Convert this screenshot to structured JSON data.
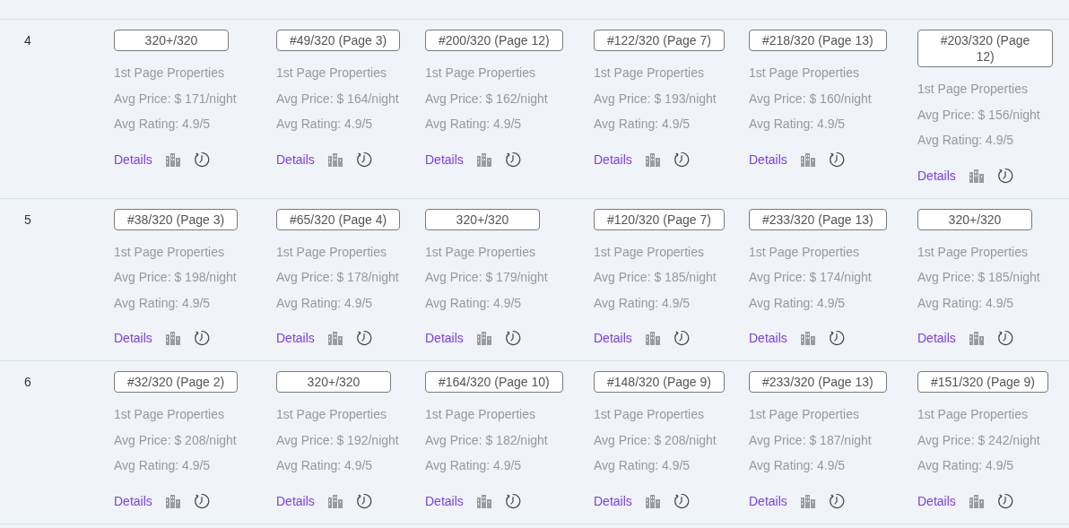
{
  "rows": [
    {
      "number": "4",
      "cells": [
        {
          "rank": "320+/320",
          "label": "1st Page Properties",
          "price": "Avg Price: $ 171/night",
          "rating": "Avg Rating: 4.9/5",
          "link": "Details"
        },
        {
          "rank": "#49/320 (Page 3)",
          "label": "1st Page Properties",
          "price": "Avg Price: $ 164/night",
          "rating": "Avg Rating: 4.9/5",
          "link": "Details"
        },
        {
          "rank": "#200/320 (Page 12)",
          "label": "1st Page Properties",
          "price": "Avg Price: $ 162/night",
          "rating": "Avg Rating: 4.9/5",
          "link": "Details"
        },
        {
          "rank": "#122/320 (Page 7)",
          "label": "1st Page Properties",
          "price": "Avg Price: $ 193/night",
          "rating": "Avg Rating: 4.9/5",
          "link": "Details"
        },
        {
          "rank": "#218/320 (Page 13)",
          "label": "1st Page Properties",
          "price": "Avg Price: $ 160/night",
          "rating": "Avg Rating: 4.9/5",
          "link": "Details"
        },
        {
          "rank": "#203/320 (Page 12)",
          "label": "1st Page Properties",
          "price": "Avg Price: $ 156/night",
          "rating": "Avg Rating: 4.9/5",
          "link": "Details"
        }
      ]
    },
    {
      "number": "5",
      "cells": [
        {
          "rank": "#38/320 (Page 3)",
          "label": "1st Page Properties",
          "price": "Avg Price: $ 198/night",
          "rating": "Avg Rating: 4.9/5",
          "link": "Details"
        },
        {
          "rank": "#65/320 (Page 4)",
          "label": "1st Page Properties",
          "price": "Avg Price: $ 178/night",
          "rating": "Avg Rating: 4.9/5",
          "link": "Details"
        },
        {
          "rank": "320+/320",
          "label": "1st Page Properties",
          "price": "Avg Price: $ 179/night",
          "rating": "Avg Rating: 4.9/5",
          "link": "Details"
        },
        {
          "rank": "#120/320 (Page 7)",
          "label": "1st Page Properties",
          "price": "Avg Price: $ 185/night",
          "rating": "Avg Rating: 4.9/5",
          "link": "Details"
        },
        {
          "rank": "#233/320 (Page 13)",
          "label": "1st Page Properties",
          "price": "Avg Price: $ 174/night",
          "rating": "Avg Rating: 4.9/5",
          "link": "Details"
        },
        {
          "rank": "320+/320",
          "label": "1st Page Properties",
          "price": "Avg Price: $ 185/night",
          "rating": "Avg Rating: 4.9/5",
          "link": "Details"
        }
      ]
    },
    {
      "number": "6",
      "cells": [
        {
          "rank": "#32/320 (Page 2)",
          "label": "1st Page Properties",
          "price": "Avg Price: $ 208/night",
          "rating": "Avg Rating: 4.9/5",
          "link": "Details"
        },
        {
          "rank": "320+/320",
          "label": "1st Page Properties",
          "price": "Avg Price: $ 192/night",
          "rating": "Avg Rating: 4.9/5",
          "link": "Details"
        },
        {
          "rank": "#164/320 (Page 10)",
          "label": "1st Page Properties",
          "price": "Avg Price: $ 182/night",
          "rating": "Avg Rating: 4.9/5",
          "link": "Details"
        },
        {
          "rank": "#148/320 (Page 9)",
          "label": "1st Page Properties",
          "price": "Avg Price: $ 208/night",
          "rating": "Avg Rating: 4.9/5",
          "link": "Details"
        },
        {
          "rank": "#233/320 (Page 13)",
          "label": "1st Page Properties",
          "price": "Avg Price: $ 187/night",
          "rating": "Avg Rating: 4.9/5",
          "link": "Details"
        },
        {
          "rank": "#151/320 (Page 9)",
          "label": "1st Page Properties",
          "price": "Avg Price: $ 242/night",
          "rating": "Avg Rating: 4.9/5",
          "link": "Details"
        }
      ]
    }
  ]
}
